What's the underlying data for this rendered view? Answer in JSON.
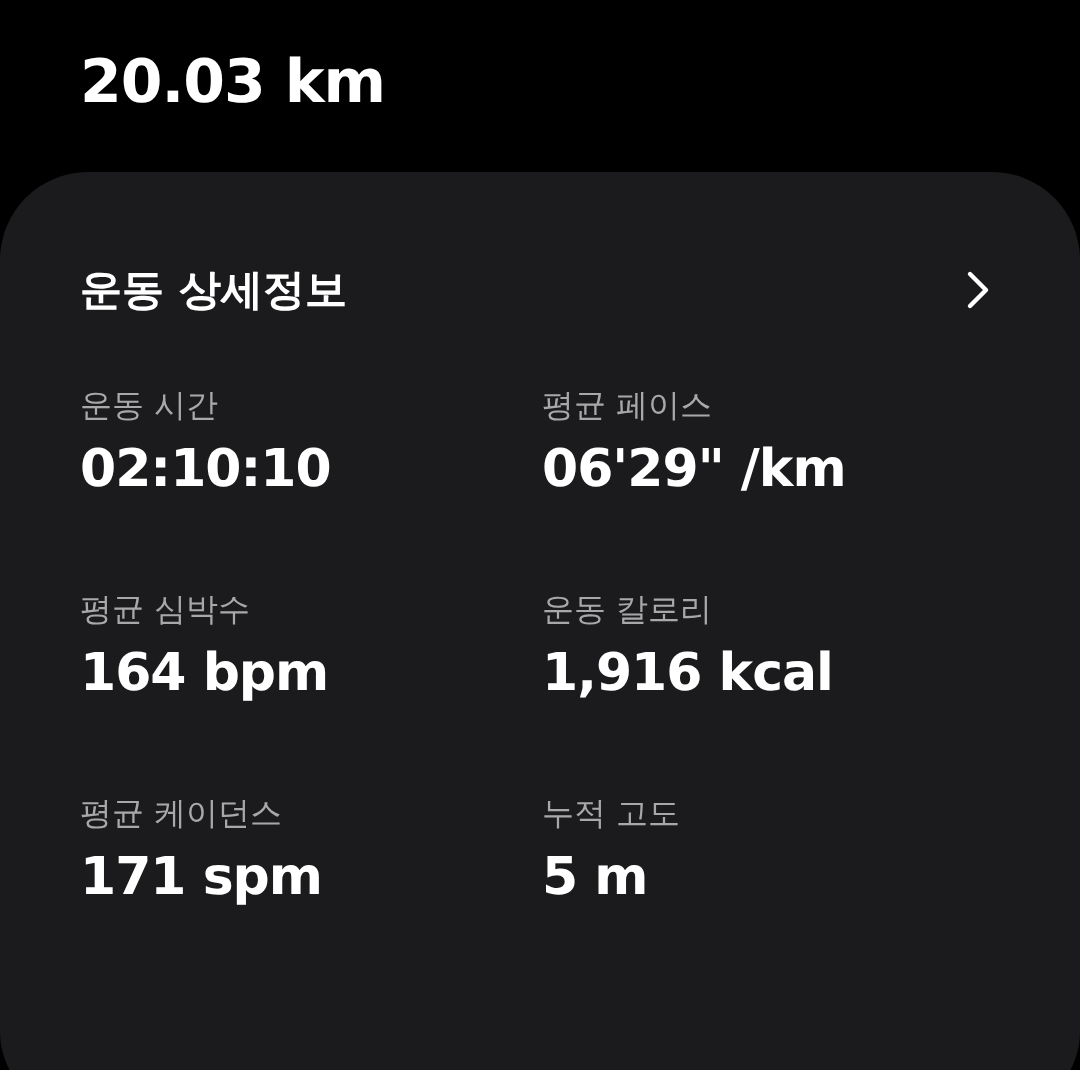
{
  "distance": "20.03 km",
  "card": {
    "title": "운동 상세정보",
    "stats": [
      {
        "label": "운동 시간",
        "value": "02:10:10"
      },
      {
        "label": "평균 페이스",
        "value": "06'29\" /km"
      },
      {
        "label": "평균 심박수",
        "value": "164 bpm"
      },
      {
        "label": "운동 칼로리",
        "value": "1,916 kcal"
      },
      {
        "label": "평균 케이던스",
        "value": "171 spm"
      },
      {
        "label": "누적 고도",
        "value": "5 m"
      }
    ]
  }
}
